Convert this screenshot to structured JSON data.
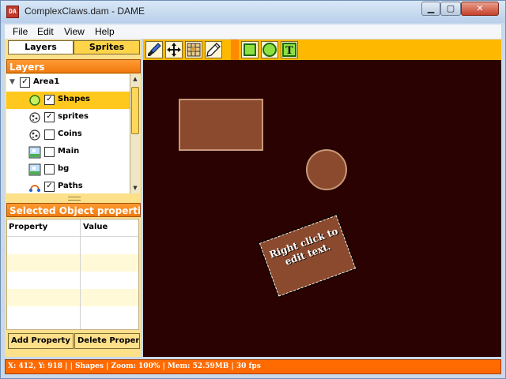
{
  "window": {
    "title": "ComplexClaws.dam - DAME",
    "app_icon_text": "DA\nME",
    "minimize_glyph": "▁",
    "maximize_glyph": "▢",
    "close_glyph": "✕"
  },
  "menubar": {
    "items": [
      "File",
      "Edit",
      "View",
      "Help"
    ]
  },
  "left_panel": {
    "tabs": [
      "Layers",
      "Sprites"
    ],
    "layers_header": "Layers",
    "tree": [
      {
        "label": "Area1",
        "checked": true,
        "icon": "expander-icon"
      },
      {
        "label": "Shapes",
        "checked": true,
        "icon": "shapes-layer-icon",
        "selected": true
      },
      {
        "label": "sprites",
        "checked": true,
        "icon": "sprite-layer-icon"
      },
      {
        "label": "Coins",
        "checked": false,
        "icon": "sprite-layer-icon"
      },
      {
        "label": "Main",
        "checked": false,
        "icon": "map-layer-icon"
      },
      {
        "label": "bg",
        "checked": false,
        "icon": "map-layer-icon"
      },
      {
        "label": "Paths",
        "checked": true,
        "icon": "path-layer-icon"
      }
    ],
    "properties_header": "Selected Object properties",
    "properties_columns": [
      "Property",
      "Value"
    ],
    "buttons": [
      "Add Property",
      "Delete Property"
    ]
  },
  "toolbar": {
    "tools": [
      "paint-brush-icon",
      "move-icon",
      "grid-select-icon",
      "pencil-icon",
      "rectangle-tool-icon",
      "circle-tool-icon",
      "text-tool-icon"
    ],
    "text_tool_glyph": "T"
  },
  "canvas": {
    "text_shape": "Right click to edit text.",
    "colors": {
      "background": "#2a0202",
      "shape_fill": "#8b4a2e",
      "shape_border": "#c89878"
    }
  },
  "statusbar": {
    "text": "X: 412, Y: 918 |   | Shapes | Zoom: 100% | Mem: 52.59MB | 30 fps"
  }
}
